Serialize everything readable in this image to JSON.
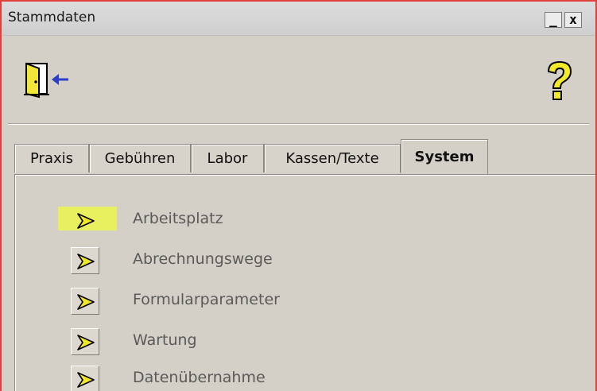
{
  "window": {
    "title": "Stammdaten",
    "minimize_label": "_",
    "close_label": "x"
  },
  "toolbar": {
    "exit_icon": "exit-door-icon",
    "help_icon": "help-question-icon"
  },
  "tabs": [
    {
      "label": "Praxis",
      "active": false
    },
    {
      "label": "Gebühren",
      "active": false
    },
    {
      "label": "Labor",
      "active": false
    },
    {
      "label": "Kassen/Texte",
      "active": false
    },
    {
      "label": "System",
      "active": true
    }
  ],
  "system_items": [
    {
      "label": "Arbeitsplatz",
      "highlighted": true
    },
    {
      "label": "Abrechnungswege",
      "highlighted": false
    },
    {
      "label": "Formularparameter",
      "highlighted": false
    },
    {
      "label": "Wartung",
      "highlighted": false
    },
    {
      "label": "Datenübernahme",
      "highlighted": false
    }
  ],
  "colors": {
    "frame_border": "#e0403c",
    "highlight": "#e8f060",
    "arrow_fill": "#f0e62a"
  }
}
